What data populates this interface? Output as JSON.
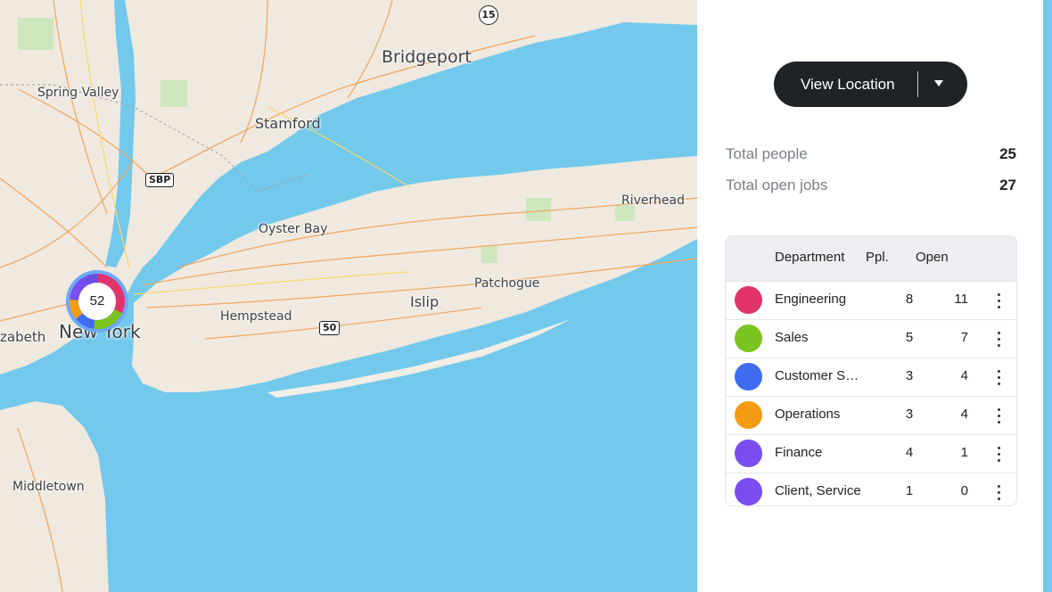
{
  "map": {
    "places": [
      {
        "name": "Bridgeport",
        "size": 19
      },
      {
        "name": "Spring Valley",
        "size": 14
      },
      {
        "name": "Stamford",
        "size": 16
      },
      {
        "name": "Riverhead",
        "size": 14
      },
      {
        "name": "Oyster Bay",
        "size": 14
      },
      {
        "name": "Patchogue",
        "size": 14
      },
      {
        "name": "Islip",
        "size": 16
      },
      {
        "name": "Hempstead",
        "size": 14
      },
      {
        "name": "New York",
        "size": 20
      },
      {
        "name": "zabeth",
        "size": 15
      },
      {
        "name": "Middletown",
        "size": 14
      }
    ],
    "shields": [
      "15",
      "SBP",
      "50"
    ],
    "cluster": {
      "count": "52",
      "segments": [
        {
          "color": "#e2336b",
          "fraction": 0.32
        },
        {
          "color": "#7cc41f",
          "fraction": 0.2
        },
        {
          "color": "#3d6cf0",
          "fraction": 0.12
        },
        {
          "color": "#f39c12",
          "fraction": 0.12
        },
        {
          "color": "#7a4df0",
          "fraction": 0.16
        },
        {
          "color": "#6a4de0",
          "fraction": 0.08
        }
      ],
      "ring_color": "#6fa8f5"
    }
  },
  "panel": {
    "top_cut_text": "...",
    "view_button": {
      "label": "View Location",
      "caret_icon": "caret-down-icon"
    },
    "stats": [
      {
        "label": "Total people",
        "value": "25"
      },
      {
        "label": "Total open jobs",
        "value": "27"
      }
    ],
    "table": {
      "headers": {
        "department": "Department",
        "ppl": "Ppl.",
        "open": "Open"
      },
      "rows": [
        {
          "name": "Engineering",
          "ppl": "8",
          "open": "11",
          "color": "#e2336b"
        },
        {
          "name": "Sales",
          "ppl": "5",
          "open": "7",
          "color": "#7cc41f"
        },
        {
          "name": "Customer S…",
          "ppl": "3",
          "open": "4",
          "color": "#3d6cf0"
        },
        {
          "name": "Operations",
          "ppl": "3",
          "open": "4",
          "color": "#f39c12"
        },
        {
          "name": "Finance",
          "ppl": "4",
          "open": "1",
          "color": "#7a4df0"
        },
        {
          "name": "Client, Service",
          "ppl": "1",
          "open": "0",
          "color": "#7a4df0"
        }
      ]
    }
  }
}
